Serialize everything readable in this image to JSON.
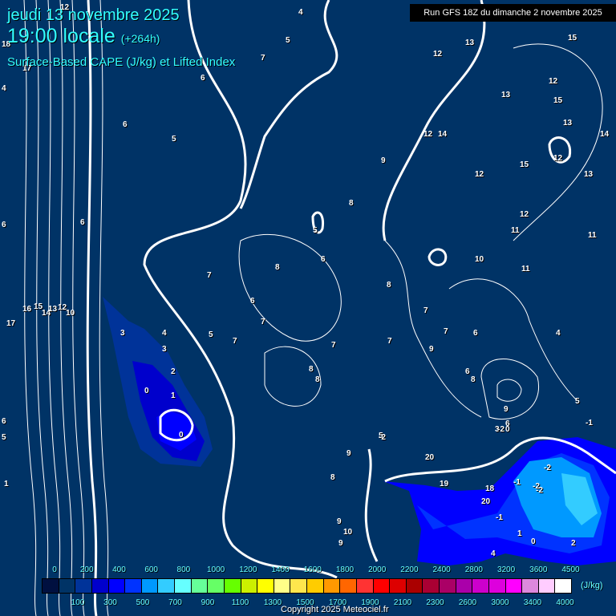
{
  "header": {
    "date": "jeudi 13 novembre 2025",
    "time": "19:00 locale",
    "lead": "(+264h)",
    "parameter": "Surface-Based CAPE (J/kg) et Lifted Index",
    "run": "Run GFS 18Z du dimanche 2 novembre 2025"
  },
  "legend": {
    "unit": "(J/kg)",
    "top_labels": [
      "0",
      "200",
      "400",
      "600",
      "800",
      "1000",
      "1200",
      "1400",
      "1600",
      "1800",
      "2000",
      "2200",
      "2400",
      "2800",
      "3200",
      "3600",
      "4500"
    ],
    "bottom_labels": [
      "100",
      "300",
      "500",
      "700",
      "900",
      "1100",
      "1300",
      "1500",
      "1700",
      "1900",
      "2100",
      "2300",
      "2600",
      "3000",
      "3400",
      "4000"
    ],
    "colors": [
      "#001040",
      "#003366",
      "#003399",
      "#0000cc",
      "#0000ff",
      "#0033ff",
      "#0099ff",
      "#33ccff",
      "#66ffff",
      "#66ff99",
      "#66ff66",
      "#66ff00",
      "#ccf000",
      "#ffff00",
      "#ffff88",
      "#ffe64d",
      "#ffcc00",
      "#ff9900",
      "#ff6600",
      "#ff3333",
      "#ff0000",
      "#dd0000",
      "#aa0000",
      "#aa0033",
      "#aa0066",
      "#aa00aa",
      "#cc00cc",
      "#dd00dd",
      "#ff00ff",
      "#dd88dd",
      "#ffccff",
      "#ffffff"
    ]
  },
  "copyright": "Copyright 2025 Meteociel.fr",
  "lifted_index_labels": [
    "12",
    "4",
    "5",
    "6",
    "7",
    "4",
    "6",
    "6",
    "5",
    "18",
    "17",
    "6",
    "16",
    "15",
    "14",
    "13",
    "12",
    "10",
    "17",
    "3",
    "4",
    "3",
    "2",
    "0",
    "1",
    "0",
    "5",
    "7",
    "6",
    "7",
    "7",
    "8",
    "8",
    "7",
    "8",
    "5",
    "6",
    "8",
    "9",
    "8",
    "7",
    "7",
    "9",
    "6",
    "7",
    "6",
    "8",
    "5",
    "9",
    "8",
    "9",
    "10",
    "9",
    "12",
    "13",
    "15",
    "12",
    "13",
    "15",
    "13",
    "14",
    "15",
    "12",
    "13",
    "12",
    "11",
    "11",
    "10",
    "11",
    "12",
    "14",
    "12",
    "9",
    "6",
    "3",
    "4",
    "5",
    "-1",
    "-2",
    "-2",
    "0",
    "-1",
    "-2",
    "-2",
    "-2",
    "-1",
    "1",
    "0",
    "2",
    "4",
    "18",
    "20",
    "19",
    "20",
    "6",
    "5",
    "1"
  ]
}
